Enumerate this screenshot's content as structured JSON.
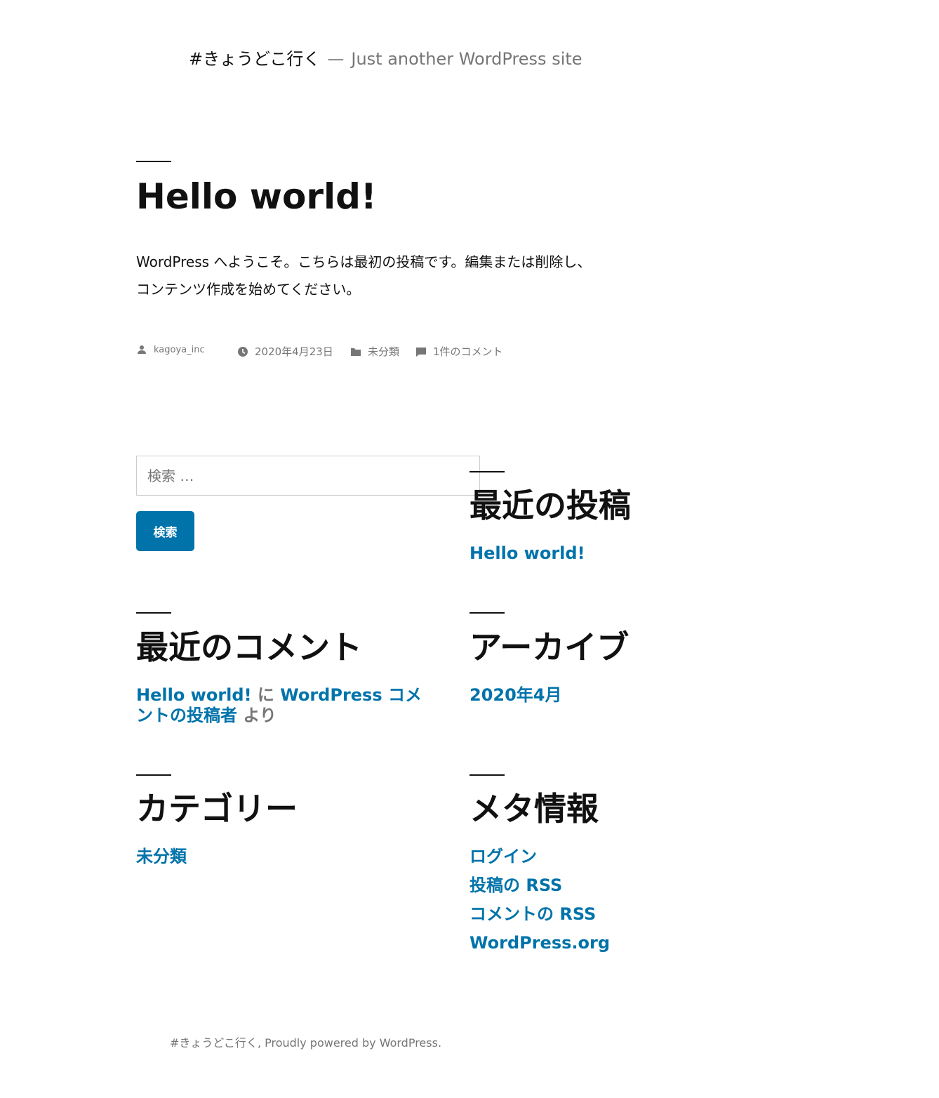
{
  "header": {
    "site_title": "#きょうどこ行く",
    "separator": "—",
    "site_description": "Just another WordPress site"
  },
  "post": {
    "title": "Hello world!",
    "content": "WordPress へようこそ。こちらは最初の投稿です。編集または削除し、コンテンツ作成を始めてください。",
    "meta": {
      "author": "kagoya_inc",
      "date": "2020年4月23日",
      "category": "未分類",
      "comments": "1件のコメント"
    }
  },
  "search": {
    "placeholder": "検索 …",
    "value": "",
    "button_label": "検索"
  },
  "widgets": {
    "recent_posts": {
      "title": "最近の投稿",
      "items": [
        "Hello world!"
      ]
    },
    "recent_comments": {
      "title": "最近のコメント",
      "post_link": "Hello world!",
      "on_text": "に",
      "author_link": "WordPress コメントの投稿者",
      "by_text": "より"
    },
    "archives": {
      "title": "アーカイブ",
      "items": [
        "2020年4月"
      ]
    },
    "categories": {
      "title": "カテゴリー",
      "items": [
        "未分類"
      ]
    },
    "meta": {
      "title": "メタ情報",
      "items": [
        "ログイン",
        "投稿の RSS",
        "コメントの RSS",
        "WordPress.org"
      ]
    }
  },
  "footer": {
    "site_name": "#きょうどこ行く",
    "comma": ",",
    "powered_text": "Proudly powered by WordPress."
  },
  "colors": {
    "text": "#111111",
    "secondary": "#767676",
    "accent": "#0073aa"
  }
}
